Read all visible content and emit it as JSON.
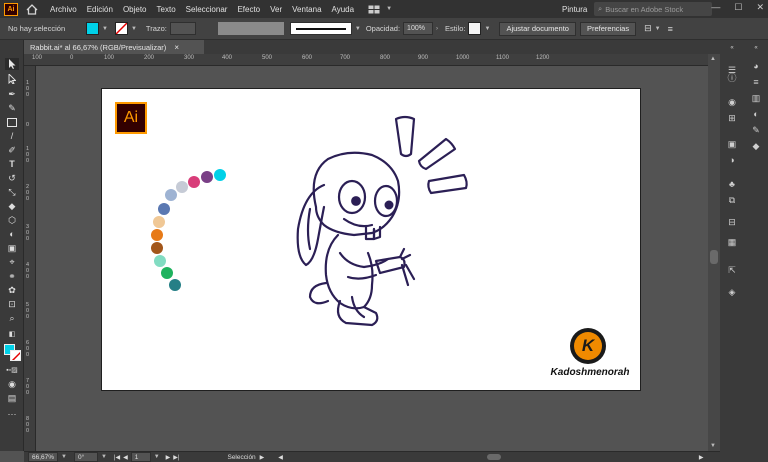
{
  "app": {
    "logo": "Ai",
    "home_icon": "home-icon"
  },
  "menu": [
    "Archivo",
    "Edición",
    "Objeto",
    "Texto",
    "Seleccionar",
    "Efecto",
    "Ver",
    "Ventana",
    "Ayuda"
  ],
  "workspace": {
    "label": "Pintura"
  },
  "stock_search": {
    "placeholder": "Buscar en Adobe Stock"
  },
  "control": {
    "selection_status": "No hay selección",
    "fill_color": "#00d1e8",
    "stroke_label": "Trazo:",
    "opacity_label": "Opacidad:",
    "opacity_value": "100%",
    "style_label": "Estilo:",
    "doc_setup_button": "Ajustar documento",
    "preferences_button": "Preferencias"
  },
  "document_tab": {
    "title": "Rabbit.ai* al 66,67% (RGB/Previsualizar)",
    "close": "×"
  },
  "ruler_top": [
    "100",
    "0",
    "100",
    "200",
    "300",
    "400",
    "500",
    "600",
    "700",
    "800",
    "900",
    "1000",
    "1100",
    "1200"
  ],
  "ruler_left": [
    "1 0 0",
    "0",
    "1 0 0",
    "2 0 0",
    "3 0 0",
    "4 0 0",
    "5 0 0",
    "6 0 0",
    "7 0 0",
    "8 0 0"
  ],
  "artboard": {
    "ai_badge": "Ai",
    "brand_letter": "K",
    "brand_name": "Kadoshmenorah",
    "palette": [
      "#00d1e8",
      "#7a3f86",
      "#d83d79",
      "#c6cbd6",
      "#9eb3d3",
      "#5a78b2",
      "#f0c896",
      "#e77a17",
      "#a2561a",
      "#82dcc2",
      "#1eb25e",
      "#257f86"
    ]
  },
  "status": {
    "zoom": "66,67%",
    "rotation": "0°",
    "artboard_number": "1",
    "tool_status": "Selección"
  }
}
